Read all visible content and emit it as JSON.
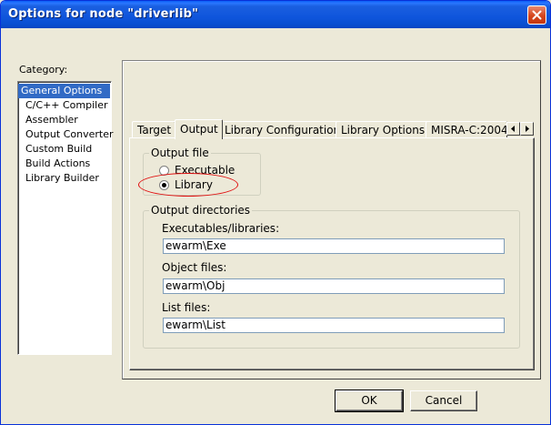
{
  "window": {
    "title": "Options for node \"driverlib\""
  },
  "category": {
    "label": "Category:",
    "items": [
      {
        "label": "General Options",
        "selected": true
      },
      {
        "label": "C/C++ Compiler"
      },
      {
        "label": "Assembler"
      },
      {
        "label": "Output Converter"
      },
      {
        "label": "Custom Build"
      },
      {
        "label": "Build Actions"
      },
      {
        "label": "Library Builder"
      }
    ]
  },
  "tabs": [
    {
      "label": "Target"
    },
    {
      "label": "Output",
      "active": true
    },
    {
      "label": "Library Configuration"
    },
    {
      "label": "Library Options"
    },
    {
      "label": "MISRA-C:2004"
    }
  ],
  "output_file": {
    "legend": "Output file",
    "options": [
      {
        "label": "Executable",
        "checked": false
      },
      {
        "label": "Library",
        "checked": true
      }
    ]
  },
  "output_directories": {
    "legend": "Output directories",
    "fields": [
      {
        "label": "Executables/libraries:",
        "value": "ewarm\\Exe"
      },
      {
        "label": "Object files:",
        "value": "ewarm\\Obj"
      },
      {
        "label": "List files:",
        "value": "ewarm\\List"
      }
    ]
  },
  "buttons": {
    "ok": "OK",
    "cancel": "Cancel"
  },
  "colors": {
    "title_bar": "#0a4fd1",
    "selection": "#316ac5",
    "annotation": "#e01010"
  }
}
